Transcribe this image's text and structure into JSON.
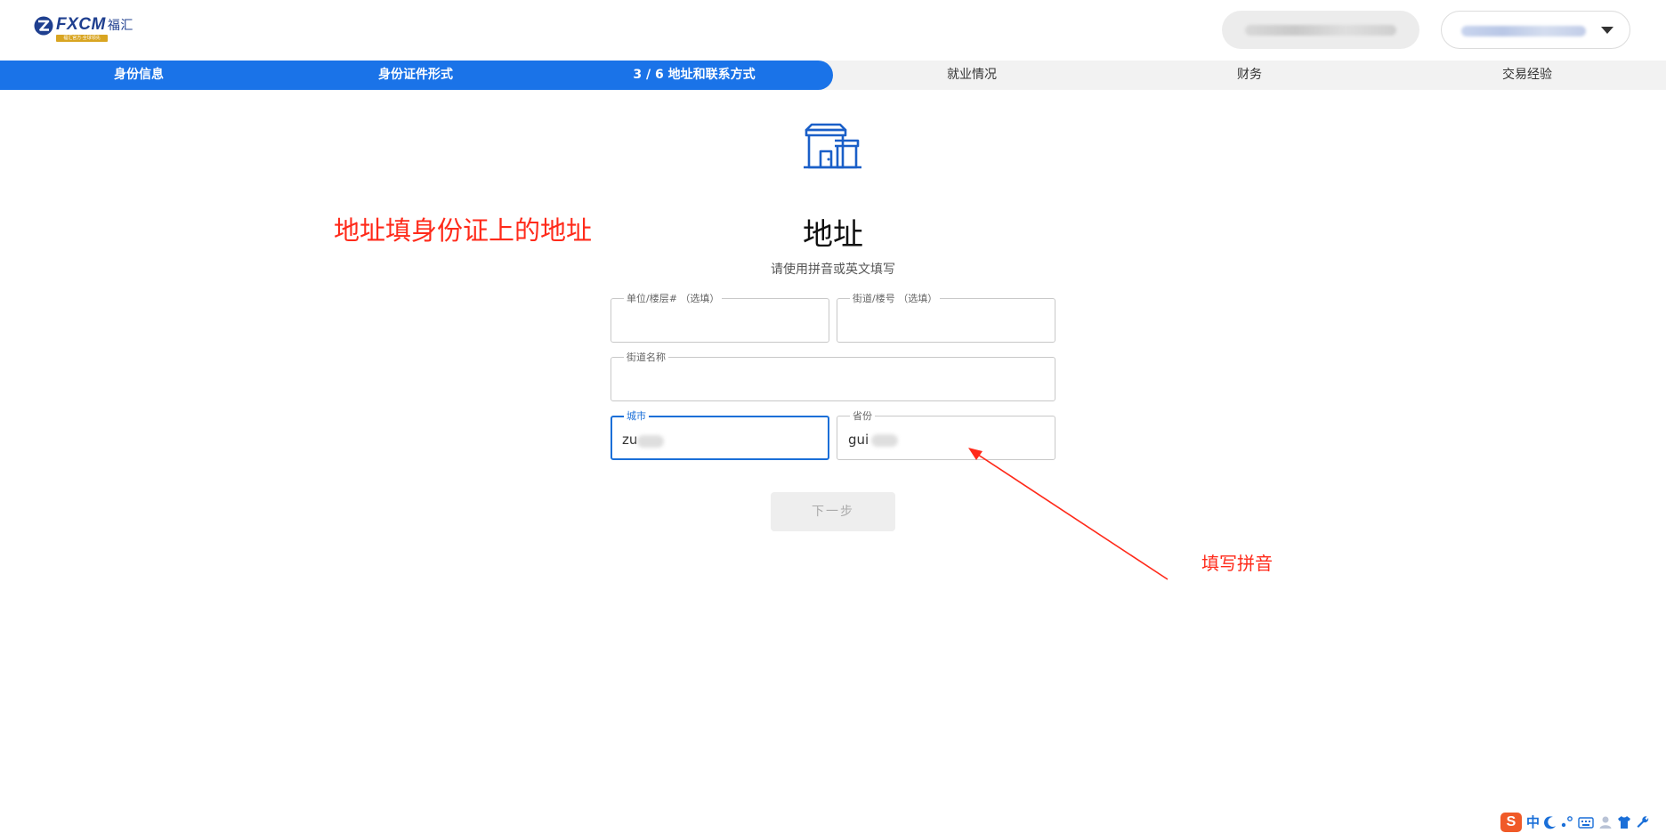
{
  "header": {
    "logo_text": "FXCM",
    "logo_cn": "福汇",
    "logo_tagline": "福汇官方·全球领先"
  },
  "steps": [
    {
      "label": "身份信息",
      "state": "done"
    },
    {
      "label": "身份证件形式",
      "state": "done"
    },
    {
      "label": "3 / 6  地址和联系方式",
      "state": "current"
    },
    {
      "label": "就业情况",
      "state": "todo"
    },
    {
      "label": "财务",
      "state": "todo"
    },
    {
      "label": "交易经验",
      "state": "todo"
    }
  ],
  "main": {
    "icon": "storefront-icon",
    "title": "地址",
    "subtitle": "请使用拼音或英文填写",
    "fields": {
      "unit": {
        "label": "单位/楼层# （选填）",
        "value": ""
      },
      "building": {
        "label": "街道/楼号 （选填）",
        "value": ""
      },
      "street": {
        "label": "街道名称",
        "value": ""
      },
      "city": {
        "label": "城市",
        "value": "zu"
      },
      "province": {
        "label": "省份",
        "value": "gui"
      }
    },
    "next_button": "下一步"
  },
  "annotations": {
    "id_note": "地址填身份证上的地址",
    "pinyin_note": "填写拼音"
  },
  "ime": {
    "logo": "S",
    "mode": "中",
    "icons": [
      "moon-icon",
      "punctuation-icon",
      "keyboard-icon",
      "user-icon",
      "shirt-icon",
      "wrench-icon"
    ]
  },
  "colors": {
    "primary": "#1a73e8",
    "annotation": "#ff2a1a",
    "step_background": "#f2f2f2"
  }
}
